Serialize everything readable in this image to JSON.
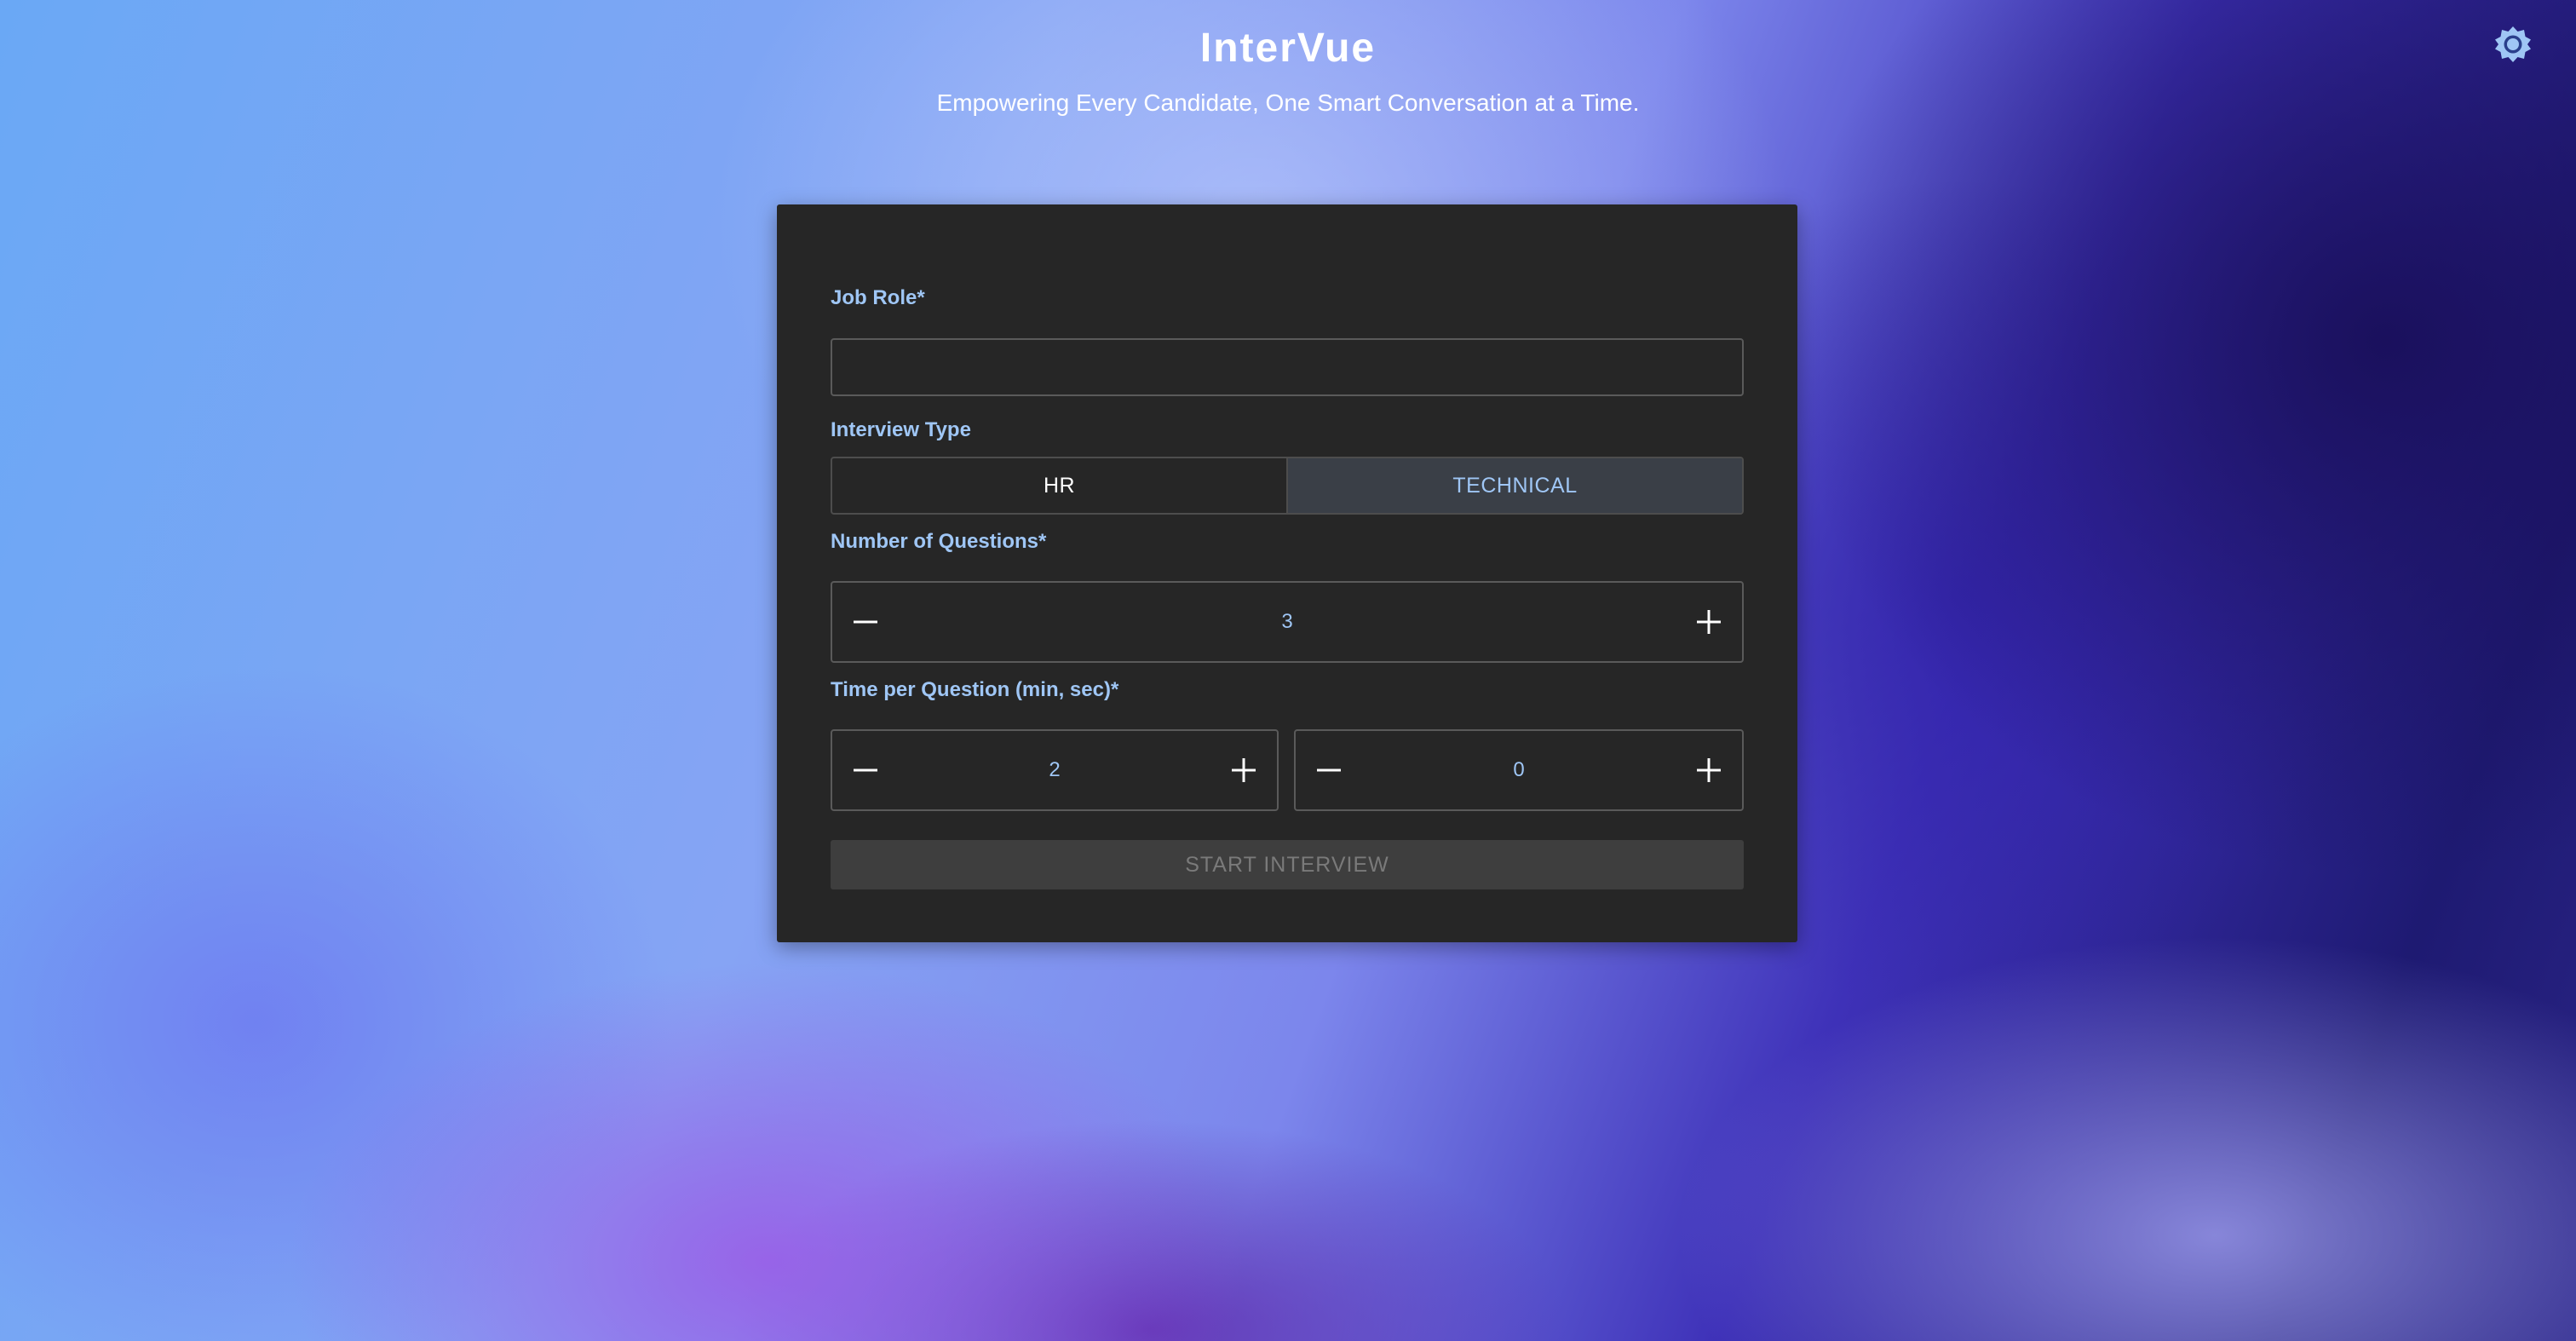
{
  "app": {
    "title": "InterVue",
    "subtitle": "Empowering Every Candidate, One Smart Conversation at a Time."
  },
  "header": {
    "theme_toggle_icon": "sun-icon"
  },
  "form": {
    "job_role": {
      "label": "Job Role*",
      "value": "",
      "placeholder": ""
    },
    "interview_type": {
      "label": "Interview Type",
      "options": [
        "HR",
        "TECHNICAL"
      ],
      "selected": "TECHNICAL"
    },
    "num_questions": {
      "label": "Number of Questions*",
      "value": "3"
    },
    "time_per_question": {
      "label": "Time per Question (min, sec)*",
      "minutes": "2",
      "seconds": "0"
    },
    "start_button": {
      "label": "START INTERVIEW",
      "disabled": true
    }
  },
  "icons": {
    "decrement": "minus-icon",
    "increment": "plus-icon"
  },
  "colors": {
    "label_accent": "#9fc6f5",
    "card_background": "#262626",
    "selected_toggle_bg": "#3a3f47",
    "disabled_button_bg": "#3e3e3e"
  }
}
